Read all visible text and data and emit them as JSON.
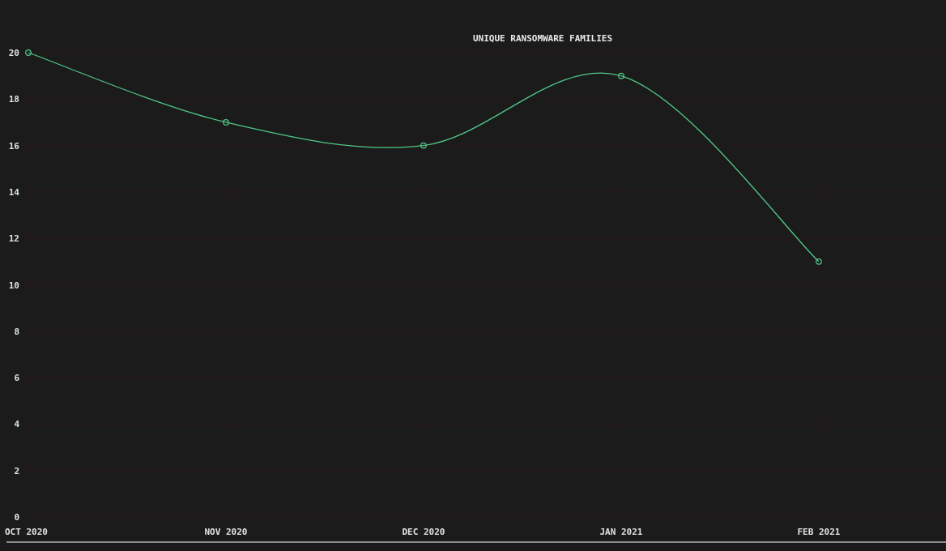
{
  "chart": {
    "chart_data": {
      "type": "line",
      "title": "UNIQUE RANSOMWARE FAMILIES",
      "categories": [
        "OCT 2020",
        "NOV 2020",
        "DEC 2020",
        "JAN 2021",
        "FEB 2021"
      ],
      "series": [
        {
          "color": "#4fc987",
          "marker": true,
          "values": [
            20,
            17,
            16,
            19,
            11
          ]
        }
      ],
      "grid": true,
      "ylim": [
        0,
        20
      ],
      "yticks": [
        0,
        2,
        4,
        6,
        8,
        10,
        12,
        14,
        16,
        18,
        20
      ]
    }
  }
}
